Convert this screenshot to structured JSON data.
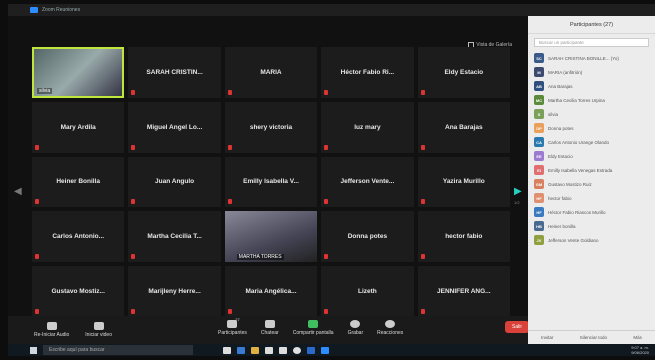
{
  "app": {
    "title": "Zoom Reuniones"
  },
  "meeting": {
    "view_label": "Vista de Galería",
    "tiles": [
      {
        "name": "silvia",
        "type": "video"
      },
      {
        "name": "SARAH CRISTIN...",
        "type": "name"
      },
      {
        "name": "MARIA",
        "type": "name"
      },
      {
        "name": "Héctor Fabio Ri...",
        "type": "name"
      },
      {
        "name": "Eldy Estacio",
        "type": "name"
      },
      {
        "name": "Mary Ardila",
        "type": "name"
      },
      {
        "name": "Miguel Angel Lo...",
        "type": "name"
      },
      {
        "name": "shery victoria",
        "type": "name"
      },
      {
        "name": "luz mary",
        "type": "name"
      },
      {
        "name": "Ana Barajas",
        "type": "name"
      },
      {
        "name": "Heiner Bonilla",
        "type": "name"
      },
      {
        "name": "Juan Angulo",
        "type": "name"
      },
      {
        "name": "Emilly Isabella V...",
        "type": "name"
      },
      {
        "name": "Jefferson Vente...",
        "type": "name"
      },
      {
        "name": "Yazira Murillo",
        "type": "name"
      },
      {
        "name": "Carlos Antonio...",
        "type": "name"
      },
      {
        "name": "Martha Cecilia T...",
        "type": "name"
      },
      {
        "name": "MARTHA TORRES",
        "type": "video2"
      },
      {
        "name": "Donna potes",
        "type": "name"
      },
      {
        "name": "hector fabio",
        "type": "name"
      },
      {
        "name": "Gustavo Mostiz...",
        "type": "name"
      },
      {
        "name": "Marijleny Herre...",
        "type": "name"
      },
      {
        "name": "Maria Angélica...",
        "type": "name"
      },
      {
        "name": "Lizeth",
        "type": "name"
      },
      {
        "name": "JENNIFER ANG...",
        "type": "name"
      }
    ],
    "page_indicator": "1/2"
  },
  "toolbar": {
    "audio": "Re-Iniciar Audio",
    "video": "Iniciar video",
    "participants": "Participantes",
    "participants_count": "27",
    "chat": "Chatear",
    "share": "Compartir pantalla",
    "record": "Grabar",
    "reactions": "Reacciones",
    "leave": "Salir"
  },
  "panel": {
    "title": "Participantes (27)",
    "search_placeholder": "Buscar un participante",
    "participants": [
      {
        "initials": "SC",
        "name": "SARAH CRISTINA BONILLE... (Yo)",
        "color": "#3a5a8a"
      },
      {
        "initials": "M",
        "name": "MARIA (anfitrión)",
        "color": "#3c4a70"
      },
      {
        "initials": "AB",
        "name": "Ana Barajas",
        "color": "#2f4f7f"
      },
      {
        "initials": "MC",
        "name": "Martha Cecilia Torres Urpina",
        "color": "#5a8a3a"
      },
      {
        "initials": "S",
        "name": "silvia",
        "color": "#7aa05a"
      },
      {
        "initials": "DP",
        "name": "Donna potes",
        "color": "#e8a05a"
      },
      {
        "initials": "CA",
        "name": "Carlos Antonio Urange Olando",
        "color": "#2a7ab0"
      },
      {
        "initials": "EE",
        "name": "Eldy Estacio",
        "color": "#9b7ad0"
      },
      {
        "initials": "EI",
        "name": "Emilly Isabella Venegas Estrada",
        "color": "#e07070"
      },
      {
        "initials": "GM",
        "name": "Gustavo Mostizo Ruiz",
        "color": "#d88060"
      },
      {
        "initials": "HF",
        "name": "hector fabio",
        "color": "#e09070"
      },
      {
        "initials": "HF",
        "name": "Héctor Fabio Riascos Murillo",
        "color": "#3a7ac0"
      },
      {
        "initials": "HB",
        "name": "Heiner bonilla",
        "color": "#4a6a90"
      },
      {
        "initials": "JV",
        "name": "Jefferson Vente Goldiano",
        "color": "#90a040"
      }
    ],
    "footer": {
      "invite": "Invitar",
      "mute_all": "Silenciar todo",
      "more": "Más"
    }
  },
  "taskbar": {
    "search_placeholder": "Escribe aquí para buscar",
    "time": "9:07 a. m.",
    "date": "9/06/2020"
  }
}
